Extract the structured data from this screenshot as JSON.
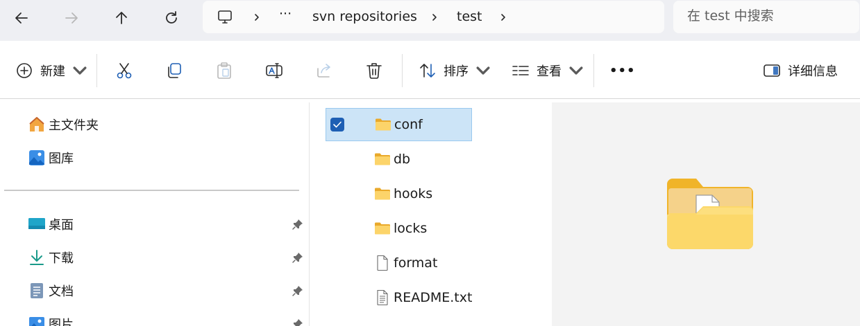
{
  "nav_buttons": {
    "back": "back-arrow-icon",
    "forward": "forward-arrow-icon",
    "up": "up-arrow-icon",
    "refresh": "refresh-icon"
  },
  "breadcrumb": {
    "root_icon": "this-pc-icon",
    "overflow": "···",
    "items": [
      "svn repositories",
      "test"
    ]
  },
  "search": {
    "placeholder": "在 test 中搜索"
  },
  "toolbar": {
    "new_label": "新建",
    "sort_label": "排序",
    "view_label": "查看",
    "more_label": "•••",
    "details_label": "详细信息"
  },
  "sidebar": {
    "top_items": [
      {
        "label": "主文件夹",
        "icon": "home-icon"
      },
      {
        "label": "图库",
        "icon": "gallery-icon"
      }
    ],
    "pinned_items": [
      {
        "label": "桌面",
        "icon": "desktop-icon"
      },
      {
        "label": "下载",
        "icon": "download-icon"
      },
      {
        "label": "文档",
        "icon": "documents-icon"
      },
      {
        "label": "图片",
        "icon": "pictures-icon"
      }
    ]
  },
  "files": [
    {
      "name": "conf",
      "type": "folder",
      "selected": true
    },
    {
      "name": "db",
      "type": "folder",
      "selected": false
    },
    {
      "name": "hooks",
      "type": "folder",
      "selected": false
    },
    {
      "name": "locks",
      "type": "folder",
      "selected": false
    },
    {
      "name": "format",
      "type": "file",
      "selected": false
    },
    {
      "name": "README.txt",
      "type": "text-file",
      "selected": false
    }
  ],
  "preview": {
    "icon": "folder-preview-icon"
  },
  "colors": {
    "accent": "#1e5fb4",
    "selection_bg": "#cce4f7",
    "folder_yellow": "#f8c846"
  }
}
